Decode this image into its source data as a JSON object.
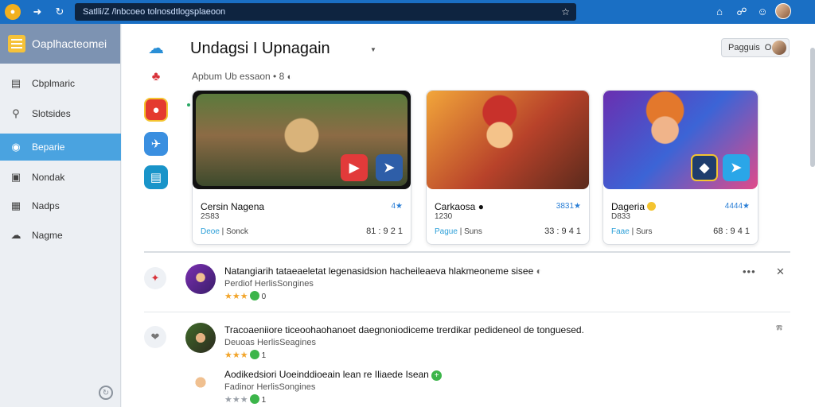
{
  "browser": {
    "address": "Satlli/Z /lnbcoeo tolnosdtlogsplaeoon",
    "star_icon": "star-icon",
    "icons": [
      "home-icon",
      "shield-icon",
      "account-icon"
    ]
  },
  "sidebar": {
    "app_title": "Oaplhacteomei",
    "items": [
      {
        "label": "Cbplmaric",
        "icon": "list-icon",
        "active": false
      },
      {
        "label": "Slotsides",
        "icon": "search-icon",
        "active": false
      },
      {
        "label": "Beparie",
        "icon": "gamepad-icon",
        "active": true
      },
      {
        "label": "Nondak",
        "icon": "window-icon",
        "active": false
      },
      {
        "label": "Nadps",
        "icon": "image-icon",
        "active": false
      },
      {
        "label": "Nagme",
        "icon": "cloud-icon",
        "active": false
      }
    ],
    "bottom_icon": "settings-icon"
  },
  "header": {
    "title": "Undagsi I Upnagain",
    "subtitle": "Apbum Ub essaon • 8",
    "sign_button": "Pagguis",
    "sign_button_control": "O"
  },
  "cards": [
    {
      "name": "Cersin Nagena",
      "rating": "4★",
      "size": "2S83",
      "publisher_tag": "Deoe",
      "publisher": "Sonck",
      "number": "81 : 9 2 1",
      "accent": "#2b9fd8"
    },
    {
      "name": "Carkaosa ●",
      "rating": "3831★",
      "size": "1230",
      "publisher_tag": "Pague",
      "publisher": "Suns",
      "number": "33 : 9 4 1",
      "accent": "#2b9fd8"
    },
    {
      "name": "Dageria",
      "rating": "4444★",
      "size": "D833",
      "publisher_tag": "Faae",
      "publisher": "Surs",
      "number": "68 : 9 4 1",
      "accent": "#2b9fd8"
    }
  ],
  "list": [
    {
      "title": "Natangiarih tataeaeletat legenasidsion hacheileaeva hlakmeoneme sisee",
      "subtitle": "Perdiof HerlisSongines",
      "stars": "★★★",
      "count": "0",
      "actions": [
        "•••",
        "✕"
      ],
      "stars_grey": false
    },
    {
      "title": "Tracoaeniiore ticeoohaohanoet daegnoniodiceme trerdikar pedideneol de tonguesed.",
      "subtitle": "Deuoas HerlisSeagines",
      "stars": "★★★",
      "count": "1",
      "actions": [
        "ⰿ"
      ],
      "stars_grey": false
    },
    {
      "title": "Aodikedsiori Uoeinddioeain lean re Iliaede Isean",
      "subtitle": "Fadinor HerlisSongines",
      "stars": "★★★",
      "count": "1",
      "actions": [],
      "stars_grey": true
    }
  ],
  "colors": {
    "accent": "#1a6fc4",
    "active": "#4aa3e0",
    "rating_blue": "#2b7fd6",
    "star": "#f2a52b"
  }
}
